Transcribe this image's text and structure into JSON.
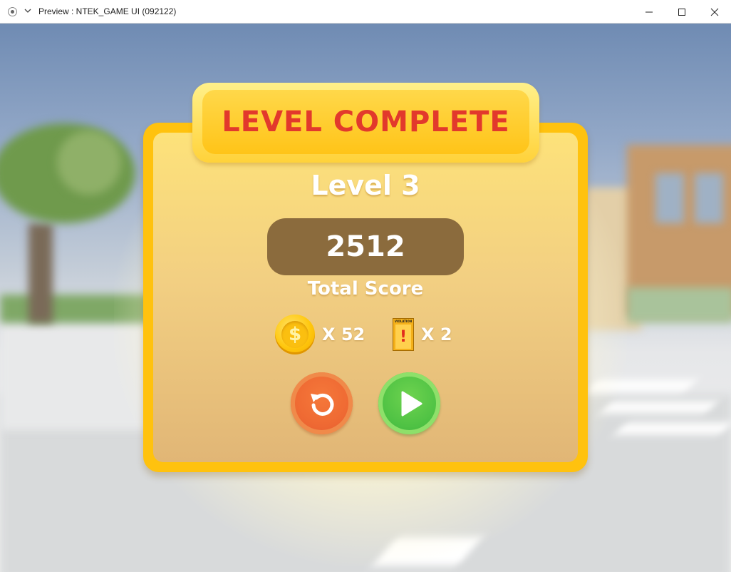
{
  "window": {
    "title": "Preview : NTEK_GAME UI (092122)",
    "icon": "record-icon",
    "controls": [
      "minimize-icon",
      "maximize-icon",
      "close-icon"
    ]
  },
  "popup": {
    "banner": "LEVEL COMPLETE",
    "level": "Level 3",
    "score": "2512",
    "score_label": "Total Score",
    "coins": {
      "icon": "coin-icon",
      "symbol": "$",
      "count": "X 52"
    },
    "violations": {
      "icon": "violation-card-icon",
      "card_label": "VIOLATION",
      "symbol": "!",
      "count": "X 2"
    },
    "buttons": [
      {
        "name": "retry",
        "icon": "restart-icon"
      },
      {
        "name": "next",
        "icon": "play-icon"
      }
    ]
  },
  "colors": {
    "banner_text": "#e2392c",
    "panel_border": "#ffc20e",
    "score_box": "#8b6b3d",
    "retry_button": "#ef6a33",
    "next_button": "#4fc244"
  }
}
